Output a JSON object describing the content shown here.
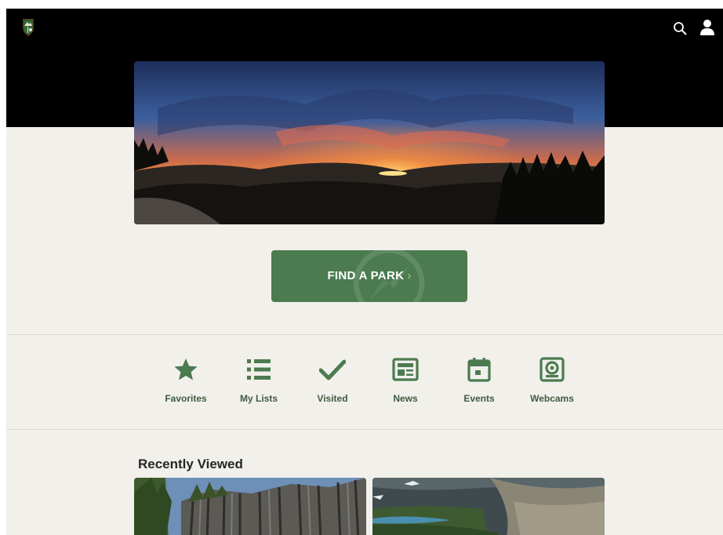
{
  "header": {
    "logo_icon": "nps-arrowhead-logo",
    "search_icon": "search-icon",
    "account_icon": "user-icon",
    "background": "#000000"
  },
  "hero": {
    "image": "sunset-over-mountain-landscape"
  },
  "find_park": {
    "label": "FIND A PARK",
    "chevron": "›",
    "color": "#4b7b4f"
  },
  "shortcuts": [
    {
      "label": "Favorites",
      "icon": "star-icon"
    },
    {
      "label": "My Lists",
      "icon": "list-icon"
    },
    {
      "label": "Visited",
      "icon": "checkmark-icon"
    },
    {
      "label": "News",
      "icon": "newspaper-icon"
    },
    {
      "label": "Events",
      "icon": "calendar-icon"
    },
    {
      "label": "Webcams",
      "icon": "webcam-icon"
    }
  ],
  "recent": {
    "title": "Recently Viewed",
    "cards": [
      {
        "image": "basalt-columns-photo"
      },
      {
        "image": "mountain-lake-valley-photo"
      }
    ]
  },
  "colors": {
    "accent": "#4b7b4f",
    "page_background": "#f1f0eb"
  }
}
